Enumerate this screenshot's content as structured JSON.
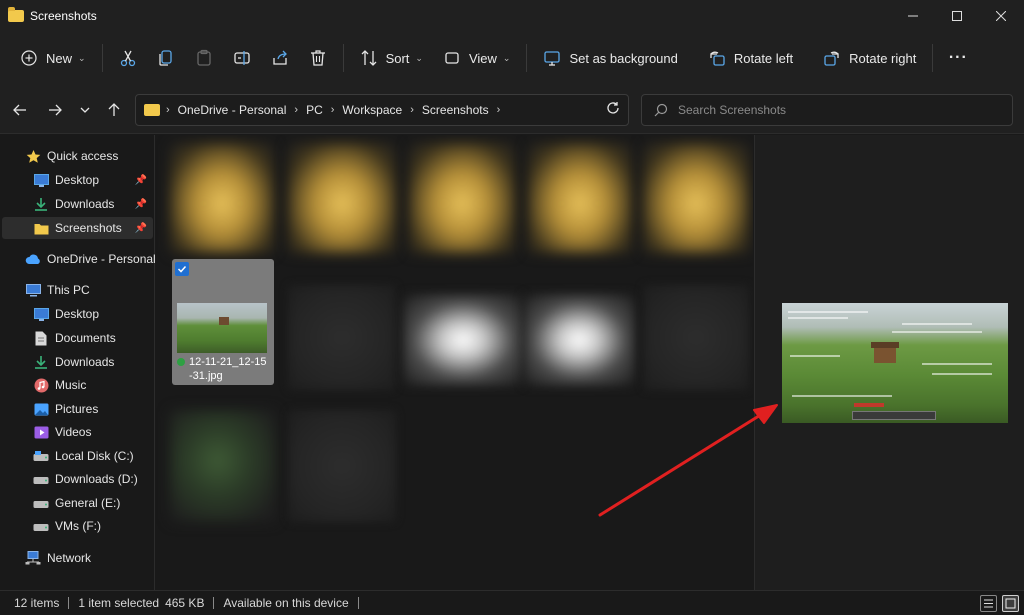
{
  "window": {
    "title": "Screenshots"
  },
  "toolbar": {
    "new_label": "New",
    "sort_label": "Sort",
    "view_label": "View",
    "set_background_label": "Set as background",
    "rotate_left_label": "Rotate left",
    "rotate_right_label": "Rotate right",
    "more_label": "···",
    "icons": [
      "cut-icon",
      "copy-icon",
      "paste-icon",
      "rename-icon",
      "share-icon",
      "delete-icon"
    ]
  },
  "address": {
    "crumbs": [
      "OneDrive - Personal",
      "PC",
      "Workspace",
      "Screenshots"
    ],
    "search_placeholder": "Search Screenshots"
  },
  "sidebar": {
    "items": [
      {
        "label": "Quick access",
        "icon": "star-icon"
      },
      {
        "label": "Desktop",
        "icon": "desktop-icon",
        "pinned": true
      },
      {
        "label": "Downloads",
        "icon": "download-icon",
        "pinned": true
      },
      {
        "label": "Screenshots",
        "icon": "folder-icon",
        "pinned": true,
        "selected": true
      },
      {
        "label": "OneDrive - Personal",
        "icon": "cloud-icon"
      },
      {
        "label": "This PC",
        "icon": "pc-icon"
      },
      {
        "label": "Desktop",
        "icon": "desktop-icon"
      },
      {
        "label": "Documents",
        "icon": "document-icon"
      },
      {
        "label": "Downloads",
        "icon": "download-icon"
      },
      {
        "label": "Music",
        "icon": "music-icon"
      },
      {
        "label": "Pictures",
        "icon": "pictures-icon"
      },
      {
        "label": "Videos",
        "icon": "videos-icon"
      },
      {
        "label": "Local Disk (C:)",
        "icon": "drive-icon"
      },
      {
        "label": "Downloads (D:)",
        "icon": "drive-icon"
      },
      {
        "label": "General (E:)",
        "icon": "drive-icon"
      },
      {
        "label": "VMs (F:)",
        "icon": "drive-icon"
      },
      {
        "label": "Network",
        "icon": "network-icon"
      }
    ]
  },
  "content": {
    "selected_file": {
      "name_line1": "12-11-21_12-15",
      "name_line2": "-31.jpg",
      "checked": true
    }
  },
  "status": {
    "item_count": "12 items",
    "selection": "1 item selected",
    "size": "465 KB",
    "availability": "Available on this device"
  },
  "colors": {
    "accent": "#1f6fd1",
    "folder": "#f2c94c",
    "arrow": "#e02020",
    "synced": "#2ea043"
  }
}
